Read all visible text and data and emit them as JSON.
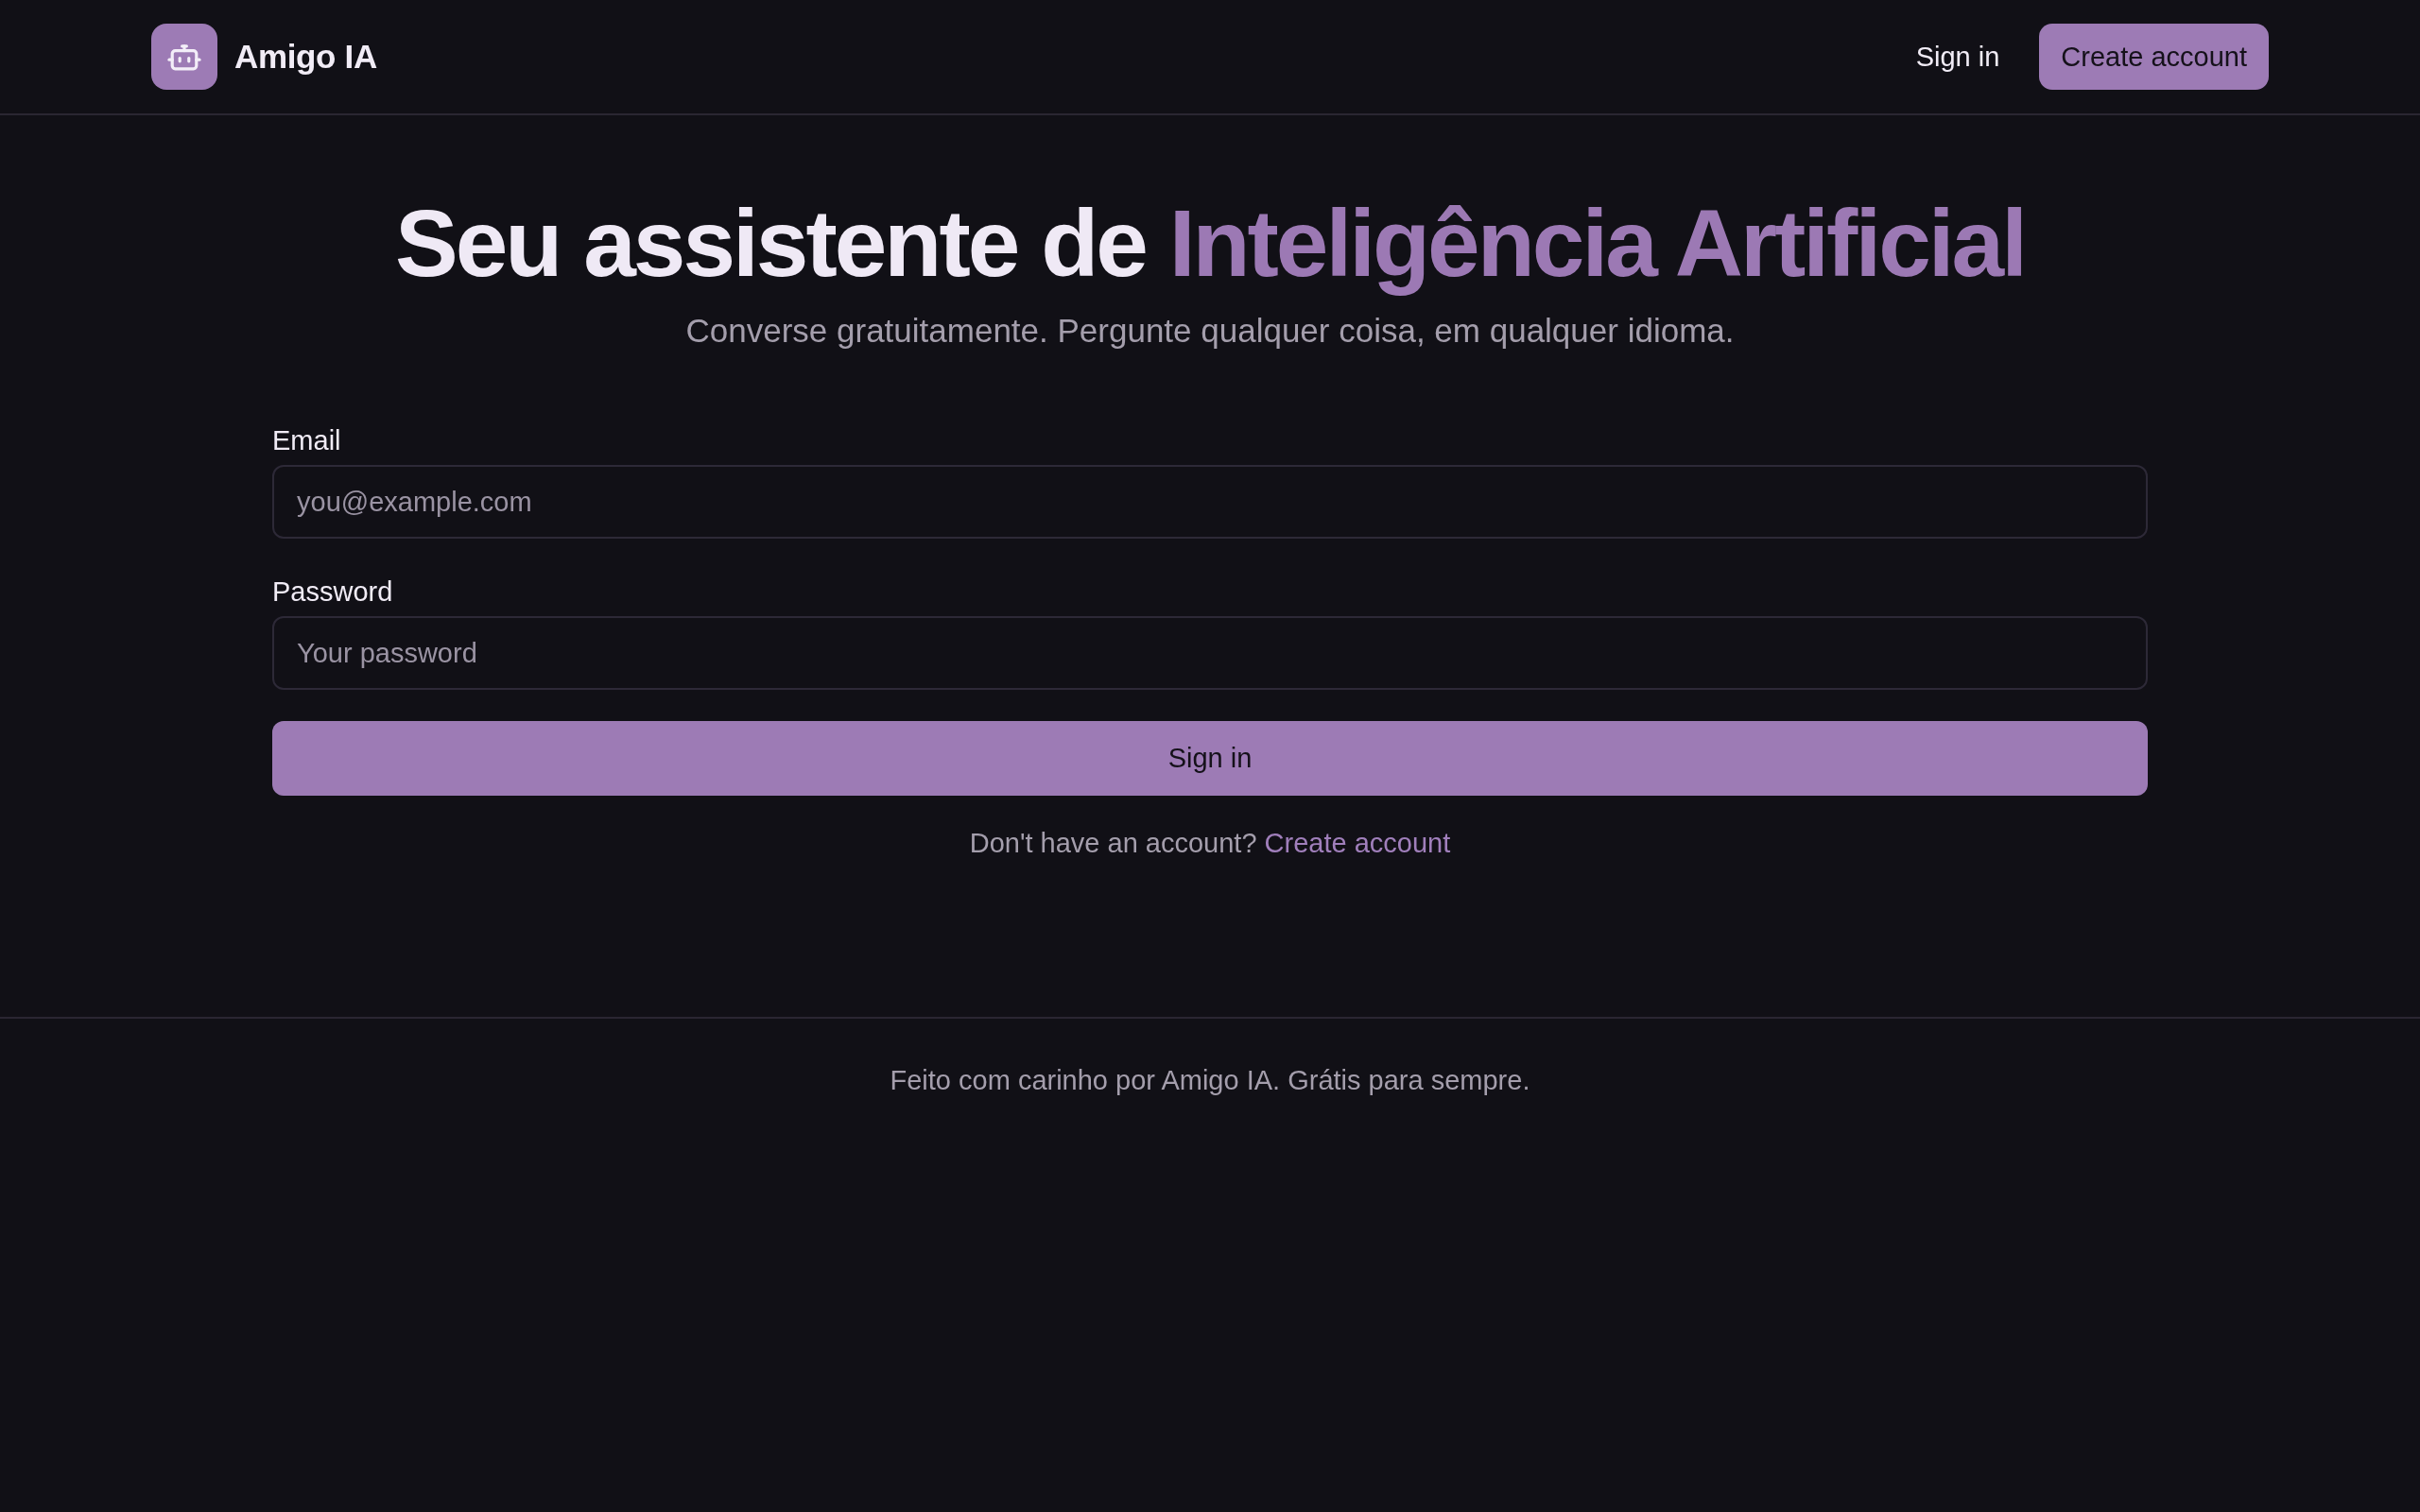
{
  "header": {
    "brand": "Amigo IA",
    "nav": [
      {
        "label": "Sign in",
        "kind": "link"
      },
      {
        "label": "Create account",
        "kind": "button"
      }
    ]
  },
  "hero": {
    "title": "Seu assistente de",
    "title_highlight": "Inteligência Artificial",
    "subtitle": "Converse gratuitamente. Pergunte qualquer coisa, em qualquer idioma."
  },
  "form": {
    "fields": [
      {
        "label": "Email",
        "placeholder": "you@example.com"
      },
      {
        "label": "Password",
        "placeholder": "Your password"
      }
    ],
    "submit": "Sign in",
    "prompt": "Don't have an account?",
    "prompt_link": "Create account"
  },
  "footer": {
    "text": "Feito com carinho por Amigo IA. Grátis para sempre."
  }
}
